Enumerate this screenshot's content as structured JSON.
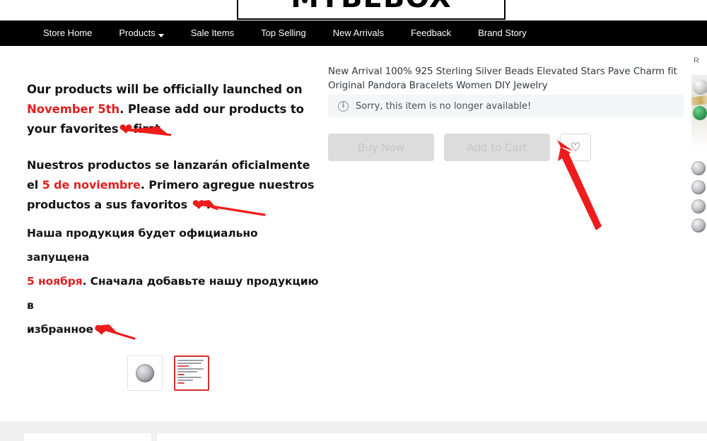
{
  "store": {
    "logo_text": "MYBEBOX"
  },
  "nav": {
    "items": [
      {
        "label": "Store Home",
        "has_caret": false
      },
      {
        "label": "Products",
        "has_caret": true
      },
      {
        "label": "Sale Items",
        "has_caret": false
      },
      {
        "label": "Top Selling",
        "has_caret": false
      },
      {
        "label": "New Arrivals",
        "has_caret": false
      },
      {
        "label": "Feedback",
        "has_caret": false
      },
      {
        "label": "Brand Story",
        "has_caret": false
      }
    ]
  },
  "promo": {
    "highlight_color": "#e02020",
    "heart_color": "#e8191a",
    "english": {
      "line1_a": "Our products will be officially launched on",
      "line2_a": "November 5th",
      "line2_b": ". Please add our products to",
      "line3_a": "your favorites",
      "line3_b": "first."
    },
    "spanish": {
      "line1_a": "Nuestros productos se lanzarán oficialmente",
      "line2_a": "el ",
      "line2_b": "5 de noviembre",
      "line2_c": ". Primero agregue nuestros",
      "line3_a": "productos a sus favoritos",
      "line3_b": "."
    },
    "russian": {
      "line1_a": "Наша продукция будет официально запущена",
      "line2_a": "5 ноября",
      "line2_b": ". Сначала добавьте нашу продукцию в",
      "line3_a": "избранное"
    }
  },
  "product": {
    "title": "New Arrival 100% 925 Sterling Silver Beads Elevated Stars Pave Charm fit Original Pandora Bracelets Women DIY Jewelry",
    "notice": {
      "icon": "info-circle-icon",
      "text": "Sorry, this item is no longer available!",
      "background": "#f3f5f7"
    },
    "actions": {
      "buy_now_label": "Buy Now",
      "add_to_cart_label": "Add to Cart",
      "wishlist_icon": "heart-outline-icon",
      "disabled_color": "#dcdcdc"
    },
    "thumbnails": [
      {
        "name": "product-photo-thumbnail",
        "selected": false
      },
      {
        "name": "promo-text-thumbnail",
        "selected": true
      }
    ]
  },
  "rail": {
    "title": "R",
    "items_count": 4
  },
  "annotations": {
    "arrow_color": "#ee1c1c",
    "pointer_target": "wishlist-heart-button"
  }
}
